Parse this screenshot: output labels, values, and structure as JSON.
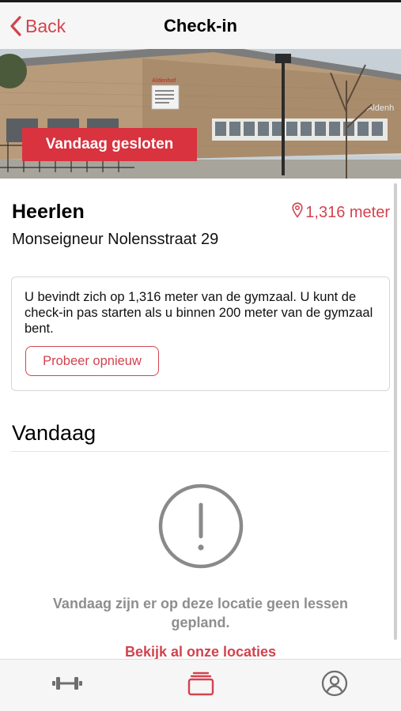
{
  "nav": {
    "back_label": "Back",
    "title": "Check-in"
  },
  "hero": {
    "status_label": "Vandaag gesloten",
    "building_sign": "Aldenhof"
  },
  "location": {
    "name": "Heerlen",
    "distance": "1,316 meter",
    "address": "Monseigneur Nolensstraat 29"
  },
  "info_card": {
    "message": "U bevindt zich op 1,316 meter van de gymzaal. U kunt de check-in pas starten als u binnen 200 meter van de gymzaal bent.",
    "retry_label": "Probeer opnieuw"
  },
  "today": {
    "title": "Vandaag",
    "empty_message": "Vandaag zijn er op deze locatie geen lessen gepland.",
    "all_locations_link": "Bekijk al onze locaties"
  },
  "tabbar": {
    "items": [
      {
        "icon": "dumbbell-icon",
        "active": false
      },
      {
        "icon": "cards-stack-icon",
        "active": true
      },
      {
        "icon": "profile-icon",
        "active": false
      }
    ]
  },
  "colors": {
    "accent": "#d2434e",
    "status_chip": "#d8333f",
    "muted_text": "#8e8e8e",
    "inactive_icon": "#6e6e6e"
  }
}
